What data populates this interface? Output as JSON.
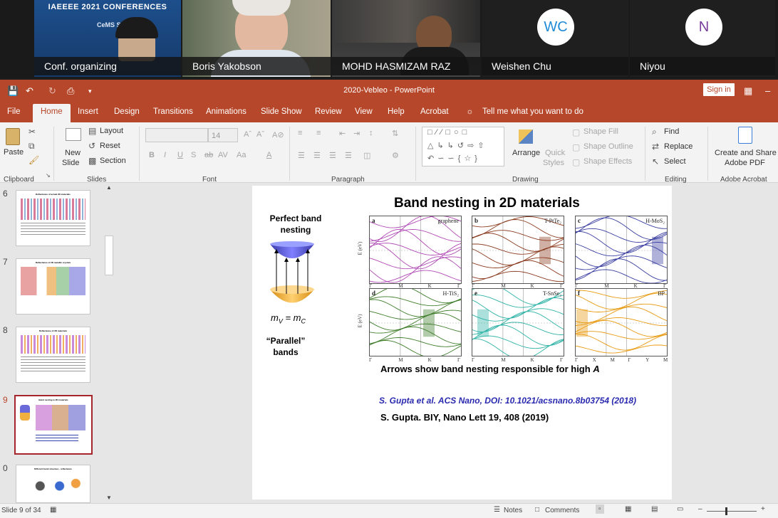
{
  "video": {
    "banner_line1": "IAEEEE 2021 CONFERENCES",
    "banner_line2": "CeMS SIS 2021",
    "participants": [
      {
        "name": "Conf. organizing"
      },
      {
        "name": "Boris Yakobson"
      },
      {
        "name": "MOHD HASMIZAM RAZ"
      },
      {
        "name": "Weishen Chu",
        "initials": "WC",
        "color": "#1f8ad6"
      },
      {
        "name": "Niyou",
        "initials": "N",
        "color": "#7a3d9c"
      }
    ]
  },
  "ppt": {
    "title": "2020-Vebleo  -  PowerPoint",
    "sign_in": "Sign in",
    "tabs": [
      "File",
      "Home",
      "Insert",
      "Design",
      "Transitions",
      "Animations",
      "Slide Show",
      "Review",
      "View",
      "Help",
      "Acrobat"
    ],
    "active_tab": "Home",
    "tell_me": "Tell me what you want to do",
    "ribbon": {
      "paste": "Paste",
      "clipboard": "Clipboard",
      "new_slide_1": "New",
      "new_slide_2": "Slide",
      "layout": "Layout",
      "reset": "Reset",
      "section": "Section",
      "slides": "Slides",
      "font_size": "14",
      "font_group": "Font",
      "paragraph": "Paragraph",
      "arrange": "Arrange",
      "quick_styles_1": "Quick",
      "quick_styles_2": "Styles",
      "shape_fill": "Shape Fill",
      "shape_outline": "Shape Outline",
      "shape_effects": "Shape Effects",
      "drawing": "Drawing",
      "find": "Find",
      "replace": "Replace",
      "select": "Select",
      "editing": "Editing",
      "create_share_1": "Create and Share",
      "create_share_2": "Adobe PDF",
      "adobe_acrobat": "Adobe Acrobat"
    },
    "thumbnails": [
      {
        "num": "6",
        "title": "Reflectance of actual 2D materials"
      },
      {
        "num": "7",
        "title": "Reflectance of 2D metallic crystals"
      },
      {
        "num": "8",
        "title": "Reflectance of 2D materials"
      },
      {
        "num": "9",
        "title": "Band nesting in 2D materials",
        "selected": true
      },
      {
        "num": "0",
        "title": "Different band structure - reflectance"
      }
    ],
    "status": {
      "slide_of": "Slide 9 of 34",
      "notes": "Notes",
      "comments": "Comments"
    }
  },
  "slide": {
    "title": "Band nesting in 2D materials",
    "perfect_1": "Perfect band",
    "perfect_2": "nesting",
    "mv": "m",
    "mv_sub": "V",
    "eq": " = m",
    "mc_sub": "C",
    "parallel_1": "“Parallel”",
    "parallel_2": "bands",
    "caption_a": "Arrows show band nesting responsible for high ",
    "caption_b": "A",
    "ref1": "S. Gupta et al. ACS Nano, DOI: 10.1021/acsnano.8b03754 (2018)",
    "ref2": "S. Gupta. BIY,  Nano Lett 19, 408 (2019)",
    "panels": [
      {
        "letter": "a",
        "material": "graphene",
        "color": "#b04ab5"
      },
      {
        "letter": "b",
        "material": "T-PtTe₂",
        "color": "#8b3a1e"
      },
      {
        "letter": "c",
        "material": "H-MoS₂",
        "color": "#3a3ea0"
      },
      {
        "letter": "d",
        "material": "H-TiS₂",
        "color": "#3e7d2a"
      },
      {
        "letter": "e",
        "material": "T-SnSe₂",
        "color": "#2fb3a6"
      },
      {
        "letter": "f",
        "material": "BP",
        "color": "#e89a10"
      }
    ],
    "energy_label": "E (eV)",
    "kpath_top": [
      "Γ",
      "M",
      "K",
      "Γ"
    ],
    "kpath_bot": [
      "Γ",
      "M",
      "K",
      "Γ"
    ],
    "kpath_bp": [
      "Γ",
      "X",
      "M",
      "Γ",
      "Y",
      "M"
    ]
  }
}
